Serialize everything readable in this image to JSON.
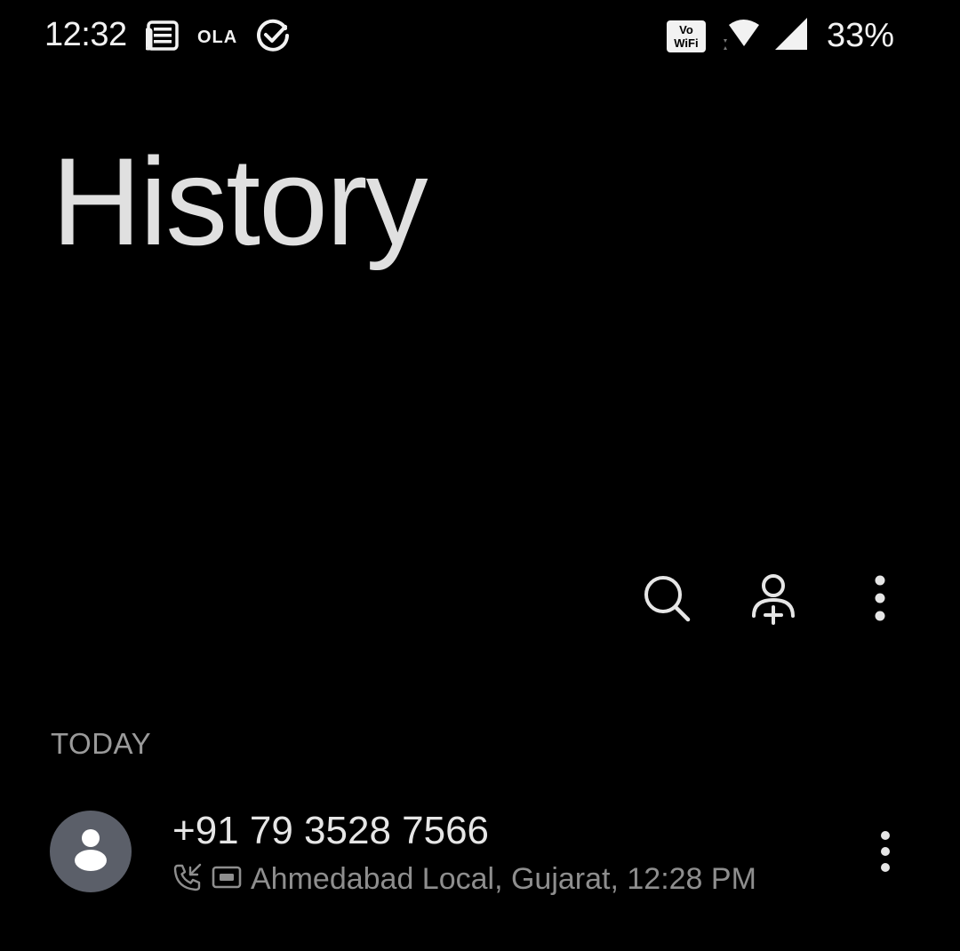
{
  "status_bar": {
    "time": "12:32",
    "left_icons": [
      "news-icon",
      "ola-icon",
      "check-circle-icon"
    ],
    "ola_label": "OLA",
    "vowifi_line1": "Vo",
    "vowifi_line2": "WiFi",
    "battery": "33%"
  },
  "header": {
    "title": "History"
  },
  "toolbar": {
    "icons": [
      "search-icon",
      "add-contact-icon",
      "more-vert-icon"
    ]
  },
  "sections": [
    {
      "label": "TODAY",
      "calls": [
        {
          "number": "+91 79 3528 7566",
          "details": "Ahmedabad Local, Gujarat, 12:28 PM",
          "icons": [
            "outgoing-call-icon",
            "sim-card-icon"
          ]
        }
      ]
    }
  ],
  "colors": {
    "background": "#000000",
    "title": "#e0e0e0",
    "secondary_text": "#8e8e8e",
    "avatar_bg": "#5b5f69"
  }
}
